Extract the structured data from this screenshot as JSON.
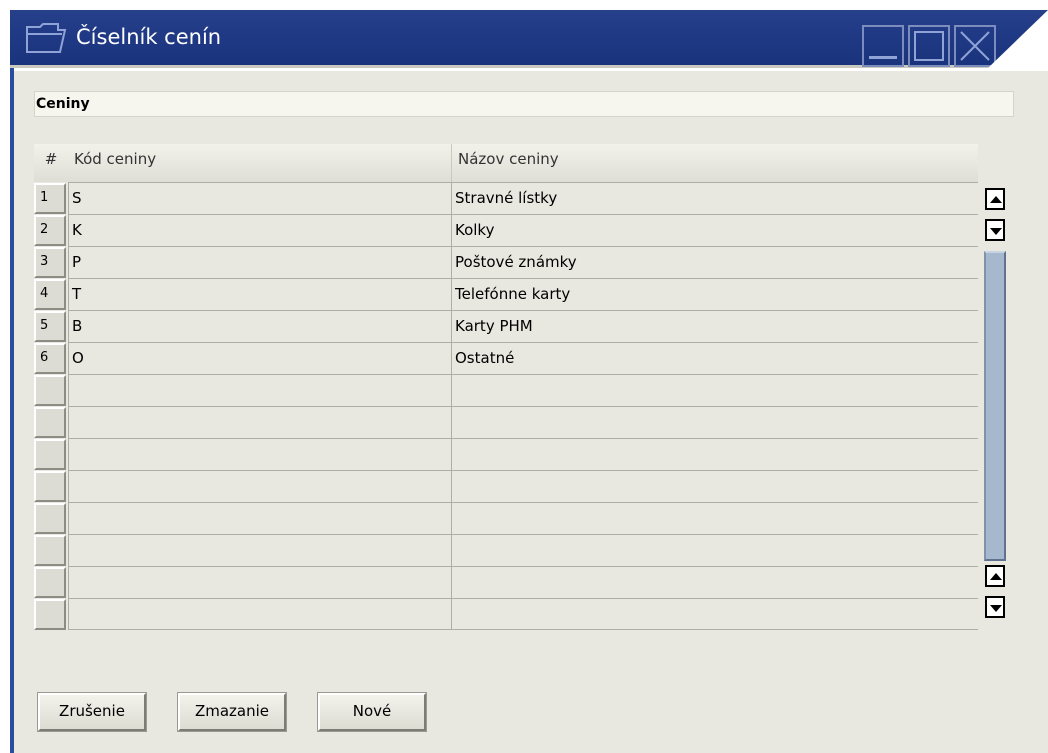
{
  "window": {
    "title": "Číselník cenín",
    "icon": "form-icon",
    "controls": [
      "minimize-icon",
      "maximize-icon",
      "close-icon"
    ]
  },
  "section": {
    "label": "Ceniny"
  },
  "table": {
    "columns": {
      "num": "#",
      "code": "Kód ceniny",
      "name": "Názov ceniny"
    },
    "rows": [
      {
        "num": "1",
        "code": "S",
        "name": "Stravné lístky"
      },
      {
        "num": "2",
        "code": "K",
        "name": "Kolky"
      },
      {
        "num": "3",
        "code": "P",
        "name": "Poštové známky"
      },
      {
        "num": "4",
        "code": "T",
        "name": "Telefónne karty"
      },
      {
        "num": "5",
        "code": "B",
        "name": "Karty PHM"
      },
      {
        "num": "6",
        "code": "O",
        "name": "Ostatné"
      },
      {
        "num": "",
        "code": "",
        "name": ""
      },
      {
        "num": "",
        "code": "",
        "name": ""
      },
      {
        "num": "",
        "code": "",
        "name": ""
      },
      {
        "num": "",
        "code": "",
        "name": ""
      },
      {
        "num": "",
        "code": "",
        "name": ""
      },
      {
        "num": "",
        "code": "",
        "name": ""
      },
      {
        "num": "",
        "code": "",
        "name": ""
      },
      {
        "num": "",
        "code": "",
        "name": ""
      }
    ]
  },
  "buttons": {
    "cancel": "Zrušenie",
    "delete": "Zmazanie",
    "new": "Nové"
  },
  "colors": {
    "titlebar": "#213a86",
    "client": "#e8e8e0",
    "scroll_thumb": "#a6b8ce"
  }
}
